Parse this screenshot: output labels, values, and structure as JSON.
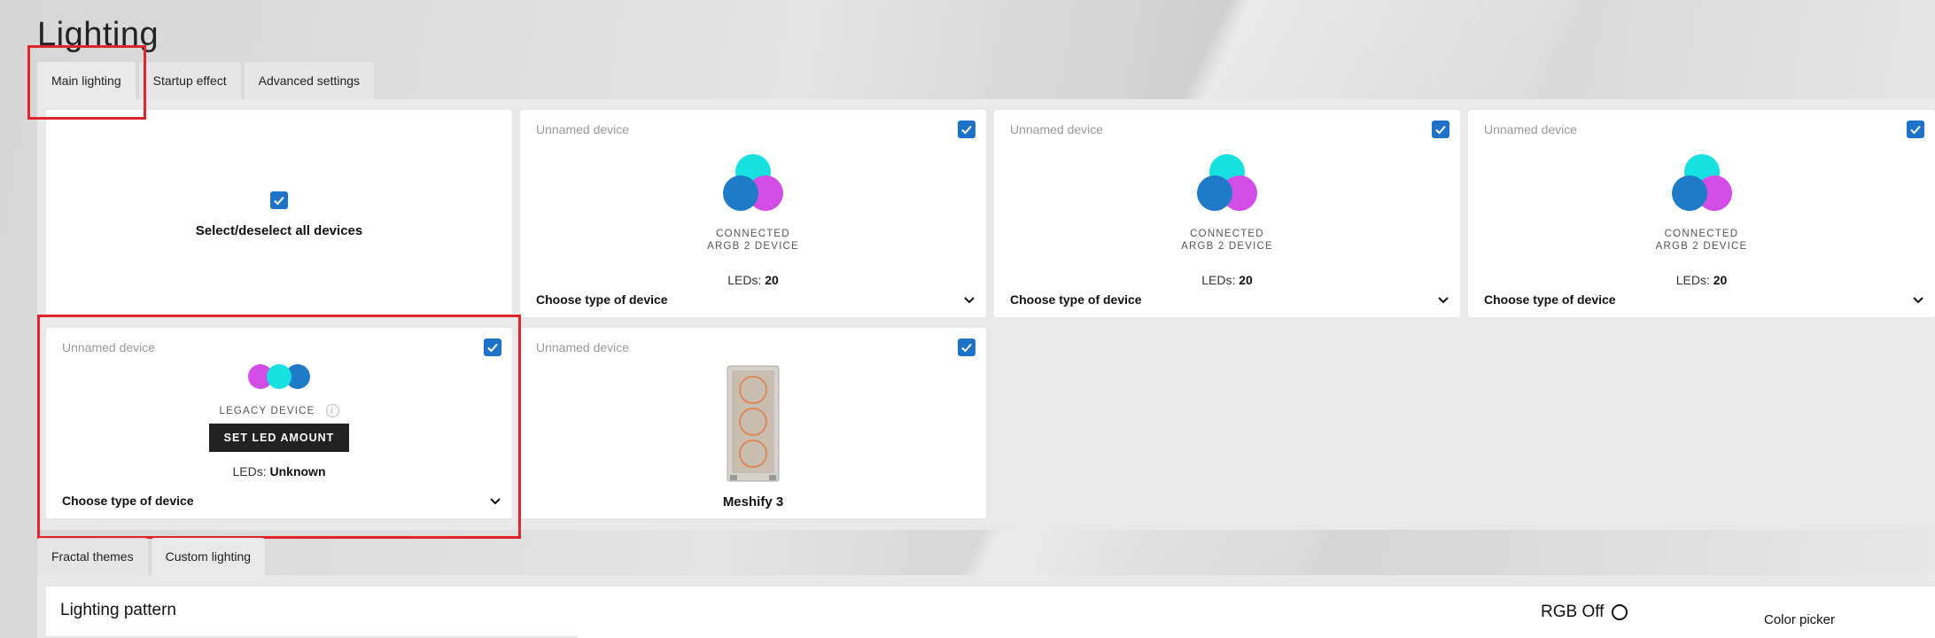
{
  "page": {
    "title": "Lighting"
  },
  "top_tabs": [
    {
      "label": "Main lighting",
      "active": true
    },
    {
      "label": "Startup effect",
      "active": false
    },
    {
      "label": "Advanced settings",
      "active": false
    }
  ],
  "select_all": {
    "label": "Select/deselect all devices",
    "checked": true
  },
  "devices": [
    {
      "name": "Unnamed device",
      "status_line1": "CONNECTED",
      "status_line2": "ARGB 2 DEVICE",
      "leds_label": "LEDs:",
      "leds_value": "20",
      "type_label": "Choose type of device",
      "checked": true
    },
    {
      "name": "Unnamed device",
      "status_line1": "CONNECTED",
      "status_line2": "ARGB 2 DEVICE",
      "leds_label": "LEDs:",
      "leds_value": "20",
      "type_label": "Choose type of device",
      "checked": true
    },
    {
      "name": "Unnamed device",
      "status_line1": "CONNECTED",
      "status_line2": "ARGB 2 DEVICE",
      "leds_label": "LEDs:",
      "leds_value": "20",
      "type_label": "Choose type of device",
      "checked": true
    }
  ],
  "legacy_device": {
    "name": "Unnamed device",
    "status": "LEGACY DEVICE",
    "info_icon": "i",
    "button_label": "SET LED AMOUNT",
    "leds_label": "LEDs:",
    "leds_value": "Unknown",
    "type_label": "Choose type of device",
    "checked": true
  },
  "case_device": {
    "name": "Unnamed device",
    "label": "Meshify 3",
    "checked": true
  },
  "bottom_tabs": [
    {
      "label": "Fractal themes",
      "active": false
    },
    {
      "label": "Custom lighting",
      "active": true
    }
  ],
  "lighting_pattern": {
    "title": "Lighting pattern",
    "rgb_off_label": "RGB Off",
    "color_picker_label": "Color picker"
  },
  "colors": {
    "accent": "#1e73c8",
    "highlight": "#e0252c",
    "cyan": "#16e0e0",
    "magenta": "#d24de6",
    "blue": "#1f7ac8"
  }
}
